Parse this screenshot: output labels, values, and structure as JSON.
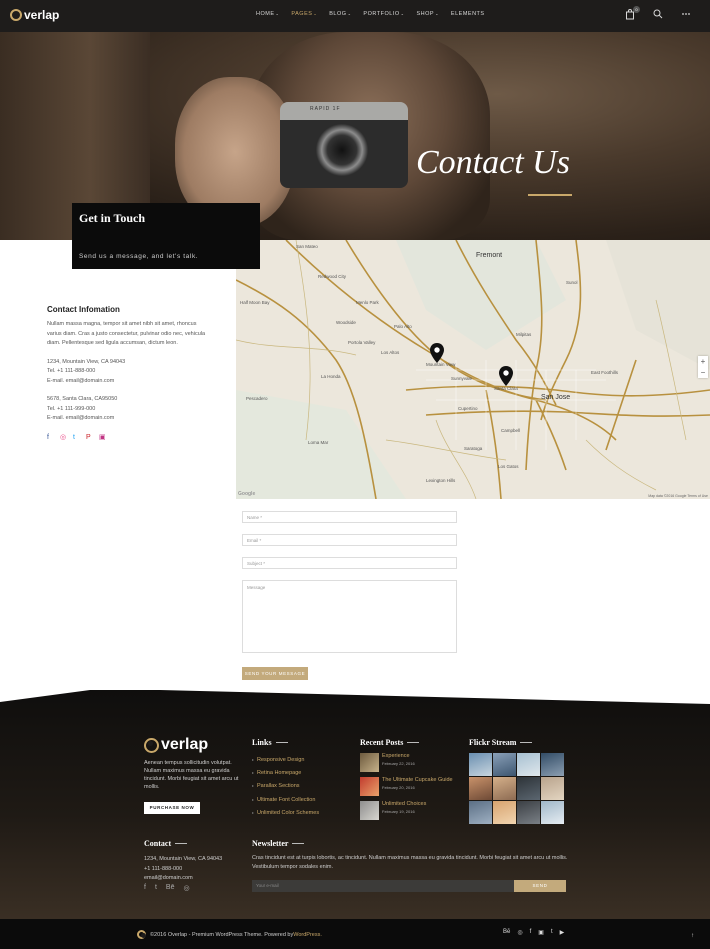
{
  "brand": {
    "name": "verlap",
    "accent": "#c9a86a"
  },
  "nav": {
    "items": [
      {
        "label": "HOME",
        "caret": "⌄"
      },
      {
        "label": "PAGES",
        "caret": "⌄"
      },
      {
        "label": "BLOG",
        "caret": "⌄"
      },
      {
        "label": "PORTFOLIO",
        "caret": "⌄"
      },
      {
        "label": "SHOP",
        "caret": "⌄"
      },
      {
        "label": "ELEMENTS",
        "caret": ""
      }
    ],
    "active": "PAGES",
    "cart_count": "0",
    "icons": [
      "cart-icon",
      "search-icon",
      "more-icon"
    ]
  },
  "hero": {
    "title": "Contact Us",
    "camera_brand": "RAPID 1F"
  },
  "touch": {
    "title": "Get in Touch",
    "subtitle": "Send us a message, and let's talk."
  },
  "contact_info": {
    "heading": "Contact Infomation",
    "text": "Nullam massa magna, tempor sit amet nibh sit amet, rhoncus varius diam. Cras a justo consectetur, pulvinar odio nec, vehicula diam. Pellentesque sed ligula accumsan, dictum leon.",
    "office1": [
      "1234, Mountain View, CA 94043",
      "Tel. +1 111-888-000",
      "E-mail. email@domain.com"
    ],
    "office2": [
      "5678, Santa Clara, CA95050",
      "Tel. +1 111-999-000",
      "E-mail. email@domain.com"
    ],
    "socials": [
      {
        "icon": "facebook-icon",
        "glyph": "f",
        "color": "#3b5998"
      },
      {
        "icon": "dribbble-icon",
        "glyph": "◎",
        "color": "#ea4c89"
      },
      {
        "icon": "twitter-icon",
        "glyph": "t",
        "color": "#1da1f2"
      },
      {
        "icon": "pinterest-icon",
        "glyph": "P",
        "color": "#cb2027"
      },
      {
        "icon": "instagram-icon",
        "glyph": "▣",
        "color": "#c13584"
      }
    ]
  },
  "map": {
    "labels": {
      "fremont": "Fremont",
      "san_jose": "San Jose",
      "palo_alto": "Palo Alto",
      "sunnyvale": "Sunnyvale",
      "santa_clara": "Santa Clara",
      "mountain_view": "Mountain View",
      "los_gatos": "Los Gatos",
      "saratoga": "Saratoga",
      "cupertino": "Cupertino",
      "campbell": "Campbell",
      "milpitas": "Milpitas",
      "redwood_city": "Redwood City",
      "menlo_park": "Menlo Park",
      "los_altos": "Los Altos",
      "san_mateo": "San Mateo",
      "la_honda": "La Honda",
      "loma_mar": "Loma Mar",
      "lexington_hills": "Lexington Hills",
      "pescadero": "Pescadero",
      "woodside": "Woodside",
      "portola_valley": "Portola Valley",
      "half_moon_bay": "Half Moon Bay",
      "sunol": "Sunol",
      "east_foothills": "East Foothills"
    },
    "zoom_in": "+",
    "zoom_out": "−",
    "attribution": "Map data ©2016 Google    Terms of Use",
    "google": "Google"
  },
  "form": {
    "name_placeholder": "Name *",
    "email_placeholder": "Email *",
    "subject_placeholder": "Subject *",
    "message_placeholder": "Message",
    "send_label": "SEND YOUR MESSAGE"
  },
  "footer": {
    "about": "Aenean tempus sollicitudin volutpat. Nullam maximus massa eu gravida tincidunt. Morbi feugiat sit amet arcu ut mollis.",
    "purchase_label": "PURCHASE NOW",
    "links_heading": "Links",
    "links": [
      "Responsive Design",
      "Retina Homepage",
      "Parallax Sections",
      "Ultimate Font Collection",
      "Unlimited Color Schemes"
    ],
    "posts_heading": "Recent Posts",
    "posts": [
      {
        "title": "Experience",
        "date": "February 22, 2016"
      },
      {
        "title": "The Ultimate Cupcake Guide",
        "date": "February 20, 2016"
      },
      {
        "title": "Unlimited Choices",
        "date": "February 19, 2016"
      }
    ],
    "flickr_heading": "Flickr Stream",
    "contact_heading": "Contact",
    "contact_lines": [
      "1234, Mountain View, CA 94043",
      "+1 111-888-000",
      "email@domain.com"
    ],
    "contact_socials": [
      "f",
      "t",
      "Bē",
      "◎"
    ],
    "newsletter_heading": "Newsletter",
    "newsletter_text": "Cras tincidunt est at turpis lobortis, ac tincidunt. Nullam maximus massa eu gravida tincidunt. Morbi feugiat sit amet arcu ut mollis. Vestibulum tempor sodales enim.",
    "email_placeholder": "Your e-mail",
    "send_label": "SEND"
  },
  "bottom": {
    "copyright": "©2016 Overlap - Premium WordPress Theme. Powered by ",
    "wp": "WordPress.",
    "socials": [
      "Bē",
      "◎",
      "f",
      "▣",
      "t",
      "▶"
    ],
    "to_top": "↑"
  }
}
